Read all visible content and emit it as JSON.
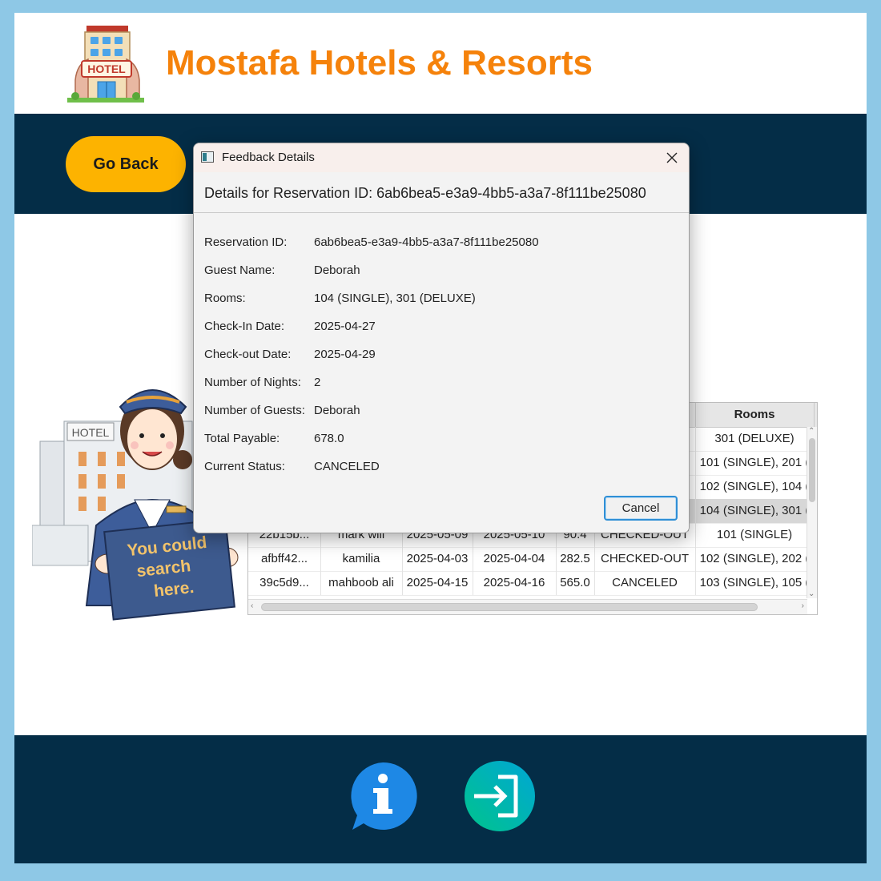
{
  "brand": {
    "title": "Mostafa Hotels & Resorts",
    "logo_sign": "HOTEL"
  },
  "nav": {
    "go_back_label": "Go Back"
  },
  "illustration": {
    "building_sign": "HOTEL",
    "sign_text": [
      "You could",
      "search",
      "here."
    ]
  },
  "table": {
    "columns": [
      "",
      "",
      "",
      "",
      "",
      "",
      "Rooms"
    ],
    "visible_rows": [
      {
        "id": "",
        "guest": "",
        "checkin": "",
        "checkout": "",
        "total": "",
        "status": "",
        "rooms": "301 (DELUXE)",
        "selected": false
      },
      {
        "id": "",
        "guest": "",
        "checkin": "",
        "checkout": "",
        "total": "",
        "status": "",
        "rooms": "101 (SINGLE), 201 (",
        "selected": false
      },
      {
        "id": "",
        "guest": "",
        "checkin": "",
        "checkout": "",
        "total": "",
        "status": "",
        "rooms": "102 (SINGLE), 104 (",
        "selected": false
      },
      {
        "id": "",
        "guest": "",
        "checkin": "",
        "checkout": "",
        "total": "",
        "status": "",
        "rooms": "104 (SINGLE), 301 (",
        "selected": true
      },
      {
        "id": "22b15b...",
        "guest": "mark will",
        "checkin": "2025-05-09",
        "checkout": "2025-05-10",
        "total": "90.4",
        "status": "CHECKED-OUT",
        "rooms": "101 (SINGLE)",
        "selected": false
      },
      {
        "id": "afbff42...",
        "guest": "kamilia",
        "checkin": "2025-04-03",
        "checkout": "2025-04-04",
        "total": "282.5",
        "status": "CHECKED-OUT",
        "rooms": "102 (SINGLE), 202 (",
        "selected": false
      },
      {
        "id": "39c5d9...",
        "guest": "mahboob ali",
        "checkin": "2025-04-15",
        "checkout": "2025-04-16",
        "total": "565.0",
        "status": "CANCELED",
        "rooms": "103 (SINGLE), 105 (",
        "selected": false
      }
    ]
  },
  "dialog": {
    "window_title": "Feedback Details",
    "header": "Details for Reservation ID: 6ab6bea5-e3a9-4bb5-a3a7-8f111be25080",
    "fields": [
      {
        "label": "Reservation ID:",
        "value": "6ab6bea5-e3a9-4bb5-a3a7-8f111be25080"
      },
      {
        "label": "Guest Name:",
        "value": "Deborah"
      },
      {
        "label": "Rooms:",
        "value": "104 (SINGLE), 301 (DELUXE)"
      },
      {
        "label": "Check-In Date:",
        "value": "2025-04-27"
      },
      {
        "label": "Check-out Date:",
        "value": "2025-04-29"
      },
      {
        "label": "Number of Nights:",
        "value": "2"
      },
      {
        "label": "Number of Guests:",
        "value": "Deborah"
      },
      {
        "label": "Total Payable:",
        "value": "678.0"
      },
      {
        "label": "Current Status:",
        "value": "CANCELED"
      }
    ],
    "cancel_label": "Cancel"
  },
  "footer": {
    "icons": [
      "info-icon",
      "logout-icon"
    ]
  },
  "colors": {
    "background": "#8ec8e6",
    "navy": "#042d47",
    "brand_orange": "#f5820b",
    "button_yellow": "#fdb300",
    "info_blue": "#1e88e5",
    "logout_green": "#00c48c"
  }
}
